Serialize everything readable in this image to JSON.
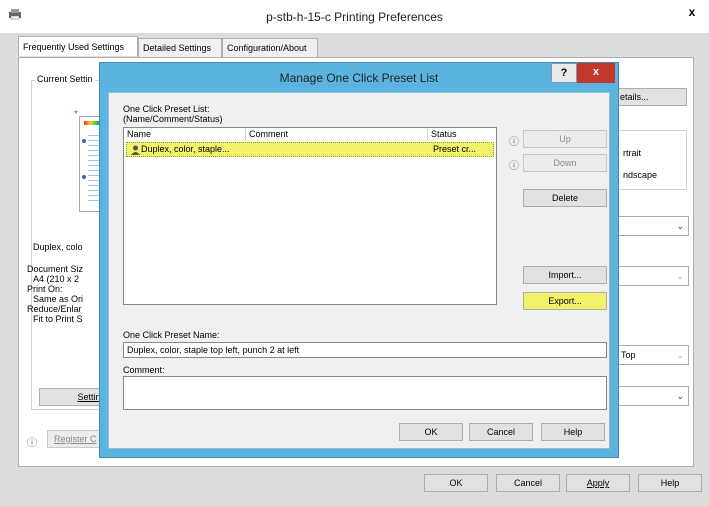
{
  "window": {
    "title": "p-stb-h-15-c Printing Preferences",
    "close_label": "x"
  },
  "tabs": [
    {
      "label": "Frequently Used Settings"
    },
    {
      "label": "Detailed Settings"
    },
    {
      "label": "Configuration/About"
    }
  ],
  "background_panel": {
    "current_settings_label": "Current Settin",
    "details_button_label": "etails...",
    "portrait_label": "rtrait",
    "landscape_label": "ndscape",
    "preset_summary": "Duplex, colo",
    "doc_size_label": "Document Siz",
    "doc_size_value": "A4 (210 x 2",
    "print_on_label": "Print On:",
    "print_on_value": "Same as Ori",
    "reduce_label": "Reduce/Enlar",
    "reduce_value": "Fit to Print S",
    "settings_button_label": "Settin",
    "register_label": "Register C",
    "combo_top_label": "Top"
  },
  "footer": {
    "ok": "OK",
    "cancel": "Cancel",
    "apply": "Apply",
    "help": "Help"
  },
  "dialog": {
    "title": "Manage One Click Preset List",
    "help_label": "?",
    "close_label": "x",
    "list_label_line1": "One Click Preset List:",
    "list_label_line2": "(Name/Comment/Status)",
    "columns": [
      "Name",
      "Comment",
      "Status"
    ],
    "rows": [
      {
        "name": "Duplex, color, staple...",
        "comment": "",
        "status": "Preset cr..."
      }
    ],
    "up_label": "Up",
    "down_label": "Down",
    "delete_label": "Delete",
    "import_label": "Import...",
    "export_label": "Export...",
    "preset_name_label": "One Click Preset Name:",
    "preset_name_value": "Duplex, color, staple top left, punch 2 at left",
    "comment_label": "Comment:",
    "comment_value": "",
    "ok": "OK",
    "cancel": "Cancel",
    "help": "Help"
  },
  "icons": {
    "info": "ⓘ"
  }
}
